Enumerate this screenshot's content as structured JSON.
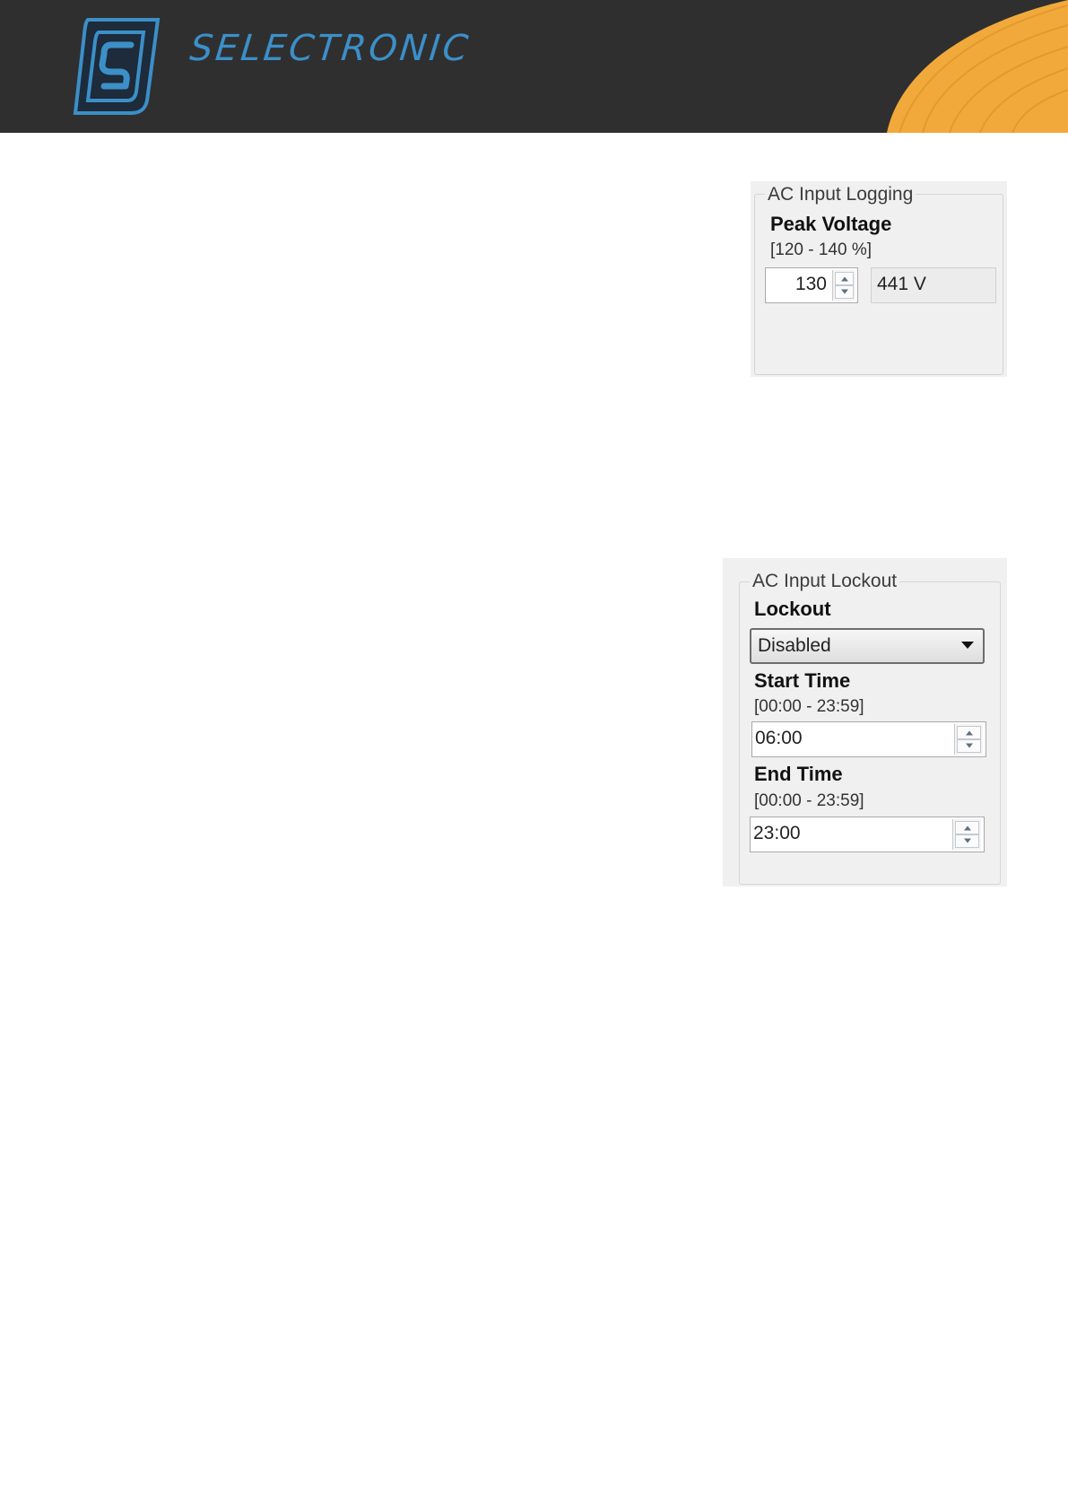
{
  "header": {
    "brand": "SELECTRONIC",
    "colors": {
      "background": "#2f2f30",
      "accent": "#f2a93b",
      "logo": "#3c8fc7"
    }
  },
  "logging_panel": {
    "group_title": "AC Input Logging",
    "peak_voltage": {
      "label": "Peak Voltage",
      "range": "[120 - 140 %]",
      "value": "130",
      "computed": "441 V"
    }
  },
  "lockout_panel": {
    "group_title": "AC Input Lockout",
    "lockout": {
      "label": "Lockout",
      "selected": "Disabled"
    },
    "start_time": {
      "label": "Start Time",
      "range": "[00:00 - 23:59]",
      "value": "06:00"
    },
    "end_time": {
      "label": "End Time",
      "range": "[00:00 - 23:59]",
      "value": "23:00"
    }
  }
}
